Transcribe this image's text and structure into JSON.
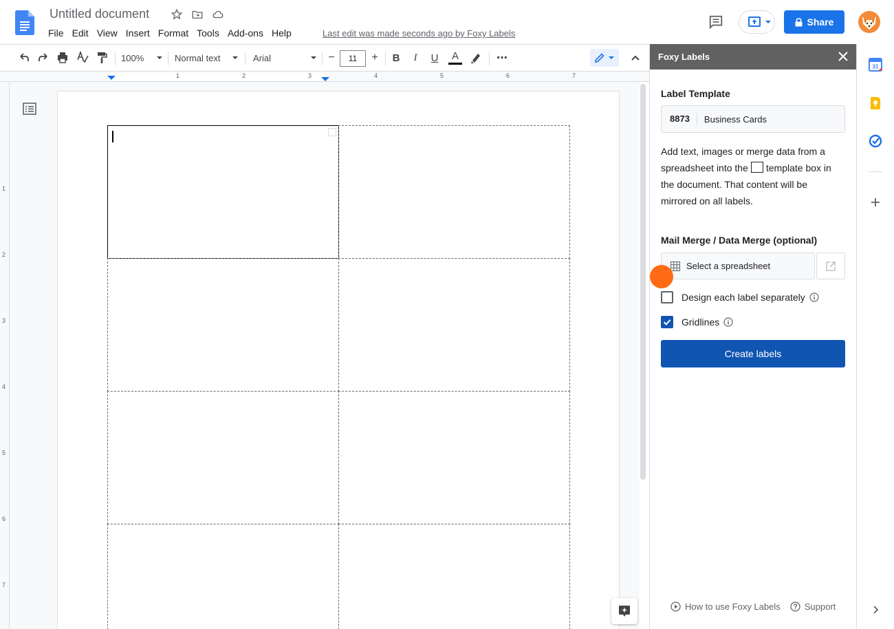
{
  "header": {
    "doc_title": "Untitled document",
    "menu": [
      "File",
      "Edit",
      "View",
      "Insert",
      "Format",
      "Tools",
      "Add-ons",
      "Help"
    ],
    "last_edit": "Last edit was made seconds ago by Foxy Labels",
    "share_label": "Share"
  },
  "toolbar": {
    "zoom": "100%",
    "style": "Normal text",
    "font": "Arial",
    "font_size": "11",
    "bold": "B",
    "italic": "I",
    "underline": "U",
    "text_color_letter": "A",
    "more": "⋯"
  },
  "ruler": {
    "numbers": [
      "1",
      "2",
      "3",
      "4",
      "5",
      "6",
      "7"
    ],
    "vnumbers": [
      "1",
      "2",
      "3",
      "4",
      "5",
      "6",
      "7"
    ]
  },
  "panel": {
    "title": "Foxy Labels",
    "label_template_heading": "Label Template",
    "template_code": "8873",
    "template_name": "Business Cards",
    "desc_part1": "Add text, images or merge data from a spreadsheet into the",
    "desc_part2": "template box in the document. That content will be mirrored on all labels.",
    "merge_heading": "Mail Merge / Data Merge (optional)",
    "select_spreadsheet": "Select a spreadsheet",
    "design_each": "Design each label separately",
    "gridlines": "Gridlines",
    "gridlines_checked": true,
    "design_each_checked": false,
    "create_button": "Create labels",
    "how_to": "How to use Foxy Labels",
    "support": "Support"
  },
  "colors": {
    "accent": "#1155b3",
    "share_blue": "#1a73e8",
    "panel_header": "#616161",
    "cursor_dot": "#ff6a13"
  }
}
